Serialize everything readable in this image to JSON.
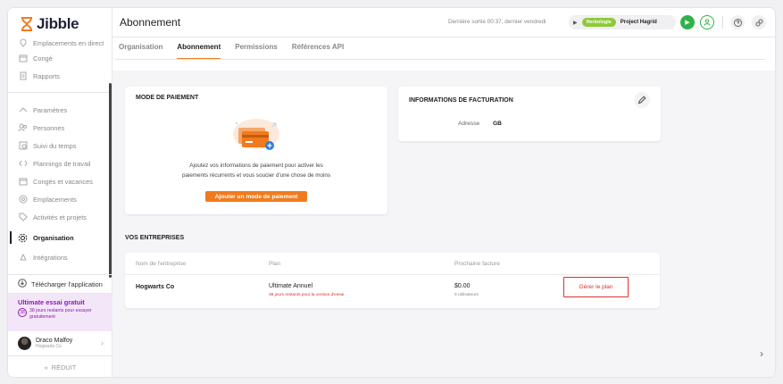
{
  "app": {
    "logo": "Jibble"
  },
  "sidebar": {
    "items": [
      {
        "label": "Emplacements en direct",
        "icon": "map-pin-icon"
      },
      {
        "label": "Congé",
        "icon": "calendar-icon"
      },
      {
        "label": "Rapports",
        "icon": "report-icon"
      },
      {
        "label": "Paramètres",
        "icon": "chevron-up-icon"
      },
      {
        "label": "Personnes",
        "icon": "people-icon"
      },
      {
        "label": "Suivi du temps",
        "icon": "time-tracking-icon"
      },
      {
        "label": "Plannings de travail",
        "icon": "schedule-icon"
      },
      {
        "label": "Congés et vacances",
        "icon": "calendar-icon"
      },
      {
        "label": "Emplacements",
        "icon": "location-icon"
      },
      {
        "label": "Activités et projets",
        "icon": "tag-icon"
      },
      {
        "label": "Organisation",
        "icon": "gear-icon"
      },
      {
        "label": "Intégrations",
        "icon": "puzzle-icon"
      }
    ],
    "download_label": "Télécharger l'application",
    "trial_title": "Ultimate essai gratuit",
    "trial_days": "38",
    "trial_sub": "38 jours restants pour essayer gratuitement",
    "user_name": "Draco Malfoy",
    "user_org": "Hogwarts Co",
    "reduce_label": "RÉDUIT"
  },
  "header": {
    "title": "Abonnement",
    "last_exit": "Dernière sortie 00:37, dernier vendredi",
    "activity_tag": "Herbologie",
    "project": "Project Hagrid"
  },
  "tabs": [
    {
      "label": "Organisation",
      "active": false
    },
    {
      "label": "Abonnement",
      "active": true
    },
    {
      "label": "Permissions",
      "active": false
    },
    {
      "label": "Références API",
      "active": false
    }
  ],
  "payment": {
    "title": "MODE DE PAIEMENT",
    "text_line1": "Ajoutez vos informations de paiement pour activer les",
    "text_line2": "paiements récurrents et vous soucier d'une chose de moins",
    "button": "Ajouter un mode de paiement"
  },
  "billing": {
    "title": "INFORMATIONS DE FACTURATION",
    "address_label": "Adresse",
    "address_value": "GB"
  },
  "companies": {
    "title": "VOS ENTREPRISES",
    "headers": [
      "Nom de l'entreprise",
      "Plan",
      "Prochaine facture"
    ],
    "row": {
      "name": "Hogwarts Co",
      "plan": "Ultimate Annuel",
      "plan_sub": "38 jours restants pour la version d'essai",
      "amount": "$0.00",
      "users": "9 utilisateurs",
      "manage": "Gérer le plan"
    }
  },
  "colors": {
    "accent": "#f07b1d",
    "green": "#2fb24a",
    "red": "#e0302f",
    "purple": "#8a1bb0"
  }
}
